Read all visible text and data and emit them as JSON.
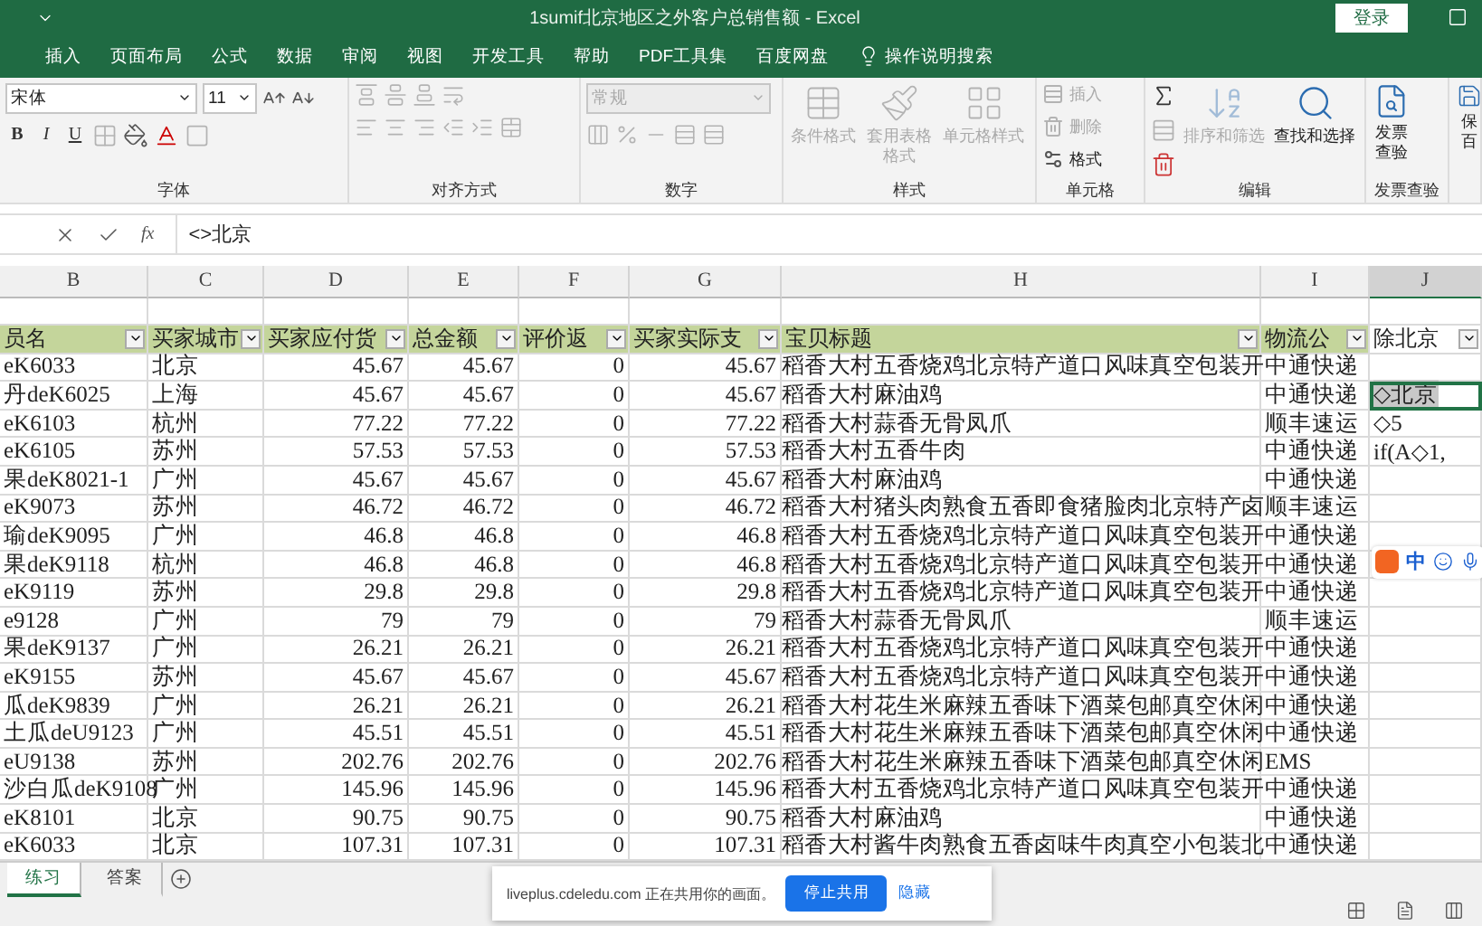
{
  "window": {
    "title": "1sumif北京地区之外客户总销售额  -  Excel",
    "login": "登录"
  },
  "ribbon_tabs": [
    {
      "label": "插入",
      "kind": "tab"
    },
    {
      "label": "页面布局",
      "kind": "tab"
    },
    {
      "label": "公式",
      "kind": "tab"
    },
    {
      "label": "数据",
      "kind": "tab"
    },
    {
      "label": "审阅",
      "kind": "tab"
    },
    {
      "label": "视图",
      "kind": "tab"
    },
    {
      "label": "开发工具",
      "kind": "tab"
    },
    {
      "label": "帮助",
      "kind": "tab"
    },
    {
      "label": "PDF工具集",
      "kind": "tab"
    },
    {
      "label": "百度网盘",
      "kind": "tab"
    },
    {
      "label": "操作说明搜索",
      "kind": "search"
    }
  ],
  "ribbon": {
    "font_name": "宋体",
    "font_size": "11",
    "bold": "B",
    "italic": "I",
    "underline": "U",
    "number_format": "常规",
    "groups": [
      {
        "label": "字体",
        "kind": "font"
      },
      {
        "label": "对齐方式",
        "kind": "align"
      },
      {
        "label": "数字",
        "kind": "number"
      },
      {
        "label": "样式",
        "kind": "styles",
        "items": [
          {
            "label": "条件格式",
            "disabled": true
          },
          {
            "label": "套用表格格式",
            "disabled": true
          },
          {
            "label": "单元格样式",
            "disabled": true
          }
        ]
      },
      {
        "label": "单元格",
        "kind": "cells",
        "items": [
          {
            "label": "插入",
            "disabled": true
          },
          {
            "label": "删除",
            "disabled": true
          },
          {
            "label": "格式",
            "disabled": false
          }
        ]
      },
      {
        "label": "编辑",
        "kind": "edit",
        "items": [
          {
            "label": "排序和筛选",
            "disabled": true
          },
          {
            "label": "查找和选择",
            "disabled": false
          }
        ]
      },
      {
        "label": "发票查验",
        "kind": "invoice",
        "items": [
          {
            "label": "发票查验",
            "disabled": false
          }
        ]
      },
      {
        "kind": "cut",
        "items": [
          {
            "label": "保百",
            "disabled": false
          }
        ]
      }
    ]
  },
  "formula_bar": {
    "fx": "fx",
    "value": "<>北京"
  },
  "columns": [
    {
      "letter": "B",
      "header": "员名",
      "kind": "text",
      "selected": false
    },
    {
      "letter": "C",
      "header": "买家城市",
      "kind": "text",
      "selected": false
    },
    {
      "letter": "D",
      "header": "买家应付货",
      "kind": "number",
      "selected": false
    },
    {
      "letter": "E",
      "header": "总金额",
      "kind": "number",
      "selected": false
    },
    {
      "letter": "F",
      "header": "评价返",
      "kind": "number",
      "selected": false
    },
    {
      "letter": "G",
      "header": "买家实际支",
      "kind": "number",
      "selected": false
    },
    {
      "letter": "H",
      "header": "宝贝标题",
      "kind": "text",
      "selected": false
    },
    {
      "letter": "I",
      "header": "物流公",
      "kind": "text",
      "selected": false
    },
    {
      "letter": "J",
      "header": "除北京",
      "kind": "text",
      "selected": true
    }
  ],
  "rows": [
    {
      "cells": [
        "eK6033",
        "北京",
        "45.67",
        "45.67",
        "0",
        "45.67",
        "稻香大村五香烧鸡北京特产道口风味真空包装开",
        "中通快递"
      ],
      "selected": false
    },
    {
      "cells": [
        "丹deK6025",
        "上海",
        "45.67",
        "45.67",
        "0",
        "45.67",
        "稻香大村麻油鸡",
        "中通快递"
      ],
      "j": "◇北京",
      "selected": true
    },
    {
      "cells": [
        "eK6103",
        "杭州",
        "77.22",
        "77.22",
        "0",
        "77.22",
        "稻香大村蒜香无骨凤爪",
        "顺丰速运"
      ],
      "j": "◇5",
      "selected": false
    },
    {
      "cells": [
        "eK6105",
        "苏州",
        "57.53",
        "57.53",
        "0",
        "57.53",
        "稻香大村五香牛肉",
        "中通快递"
      ],
      "j": "if(A◇1,",
      "selected": false
    },
    {
      "cells": [
        "果deK8021-1",
        "广州",
        "45.67",
        "45.67",
        "0",
        "45.67",
        "稻香大村麻油鸡",
        "中通快递"
      ],
      "selected": false
    },
    {
      "cells": [
        "eK9073",
        "苏州",
        "46.72",
        "46.72",
        "0",
        "46.72",
        "稻香大村猪头肉熟食五香即食猪脸肉北京特产卤",
        "顺丰速运"
      ],
      "selected": false
    },
    {
      "cells": [
        "瑜deK9095",
        "广州",
        "46.8",
        "46.8",
        "0",
        "46.8",
        "稻香大村五香烧鸡北京特产道口风味真空包装开",
        "中通快递"
      ],
      "selected": false
    },
    {
      "cells": [
        "果deK9118",
        "杭州",
        "46.8",
        "46.8",
        "0",
        "46.8",
        "稻香大村五香烧鸡北京特产道口风味真空包装开",
        "中通快递"
      ],
      "selected": false
    },
    {
      "cells": [
        "eK9119",
        "苏州",
        "29.8",
        "29.8",
        "0",
        "29.8",
        "稻香大村五香烧鸡北京特产道口风味真空包装开",
        "中通快递"
      ],
      "selected": false
    },
    {
      "cells": [
        "e9128",
        "广州",
        "79",
        "79",
        "0",
        "79",
        "稻香大村蒜香无骨凤爪",
        "顺丰速运"
      ],
      "selected": false
    },
    {
      "cells": [
        "果deK9137",
        "广州",
        "26.21",
        "26.21",
        "0",
        "26.21",
        "稻香大村五香烧鸡北京特产道口风味真空包装开",
        "中通快递"
      ],
      "selected": false
    },
    {
      "cells": [
        "eK9155",
        "苏州",
        "45.67",
        "45.67",
        "0",
        "45.67",
        "稻香大村五香烧鸡北京特产道口风味真空包装开",
        "中通快递"
      ],
      "selected": false
    },
    {
      "cells": [
        "瓜deK9839",
        "广州",
        "26.21",
        "26.21",
        "0",
        "26.21",
        "稻香大村花生米麻辣五香味下酒菜包邮真空休闲",
        "中通快递"
      ],
      "selected": false
    },
    {
      "cells": [
        "土瓜deU9123",
        "广州",
        "45.51",
        "45.51",
        "0",
        "45.51",
        "稻香大村花生米麻辣五香味下酒菜包邮真空休闲",
        "中通快递"
      ],
      "selected": false
    },
    {
      "cells": [
        "eU9138",
        "苏州",
        "202.76",
        "202.76",
        "0",
        "202.76",
        "稻香大村花生米麻辣五香味下酒菜包邮真空休闲",
        "EMS"
      ],
      "selected": false
    },
    {
      "cells": [
        "沙白瓜deK9108",
        "广州",
        "145.96",
        "145.96",
        "0",
        "145.96",
        "稻香大村五香烧鸡北京特产道口风味真空包装开",
        "中通快递"
      ],
      "selected": false
    },
    {
      "cells": [
        "eK8101",
        "北京",
        "90.75",
        "90.75",
        "0",
        "90.75",
        "稻香大村麻油鸡",
        "中通快递"
      ],
      "selected": false
    },
    {
      "cells": [
        "eK6033",
        "北京",
        "107.31",
        "107.31",
        "0",
        "107.31",
        "稻香大村酱牛肉熟食五香卤味牛肉真空小包装北",
        "中通快递"
      ],
      "selected": false
    }
  ],
  "sheet_tabs": [
    {
      "label": "练习",
      "selected": true
    },
    {
      "label": "答案",
      "selected": false
    }
  ],
  "share_notice": {
    "text": "liveplus.cdeledu.com 正在共用你的画面。",
    "stop": "停止共用",
    "hide": "隐藏"
  },
  "ime": {
    "mode": "中"
  }
}
